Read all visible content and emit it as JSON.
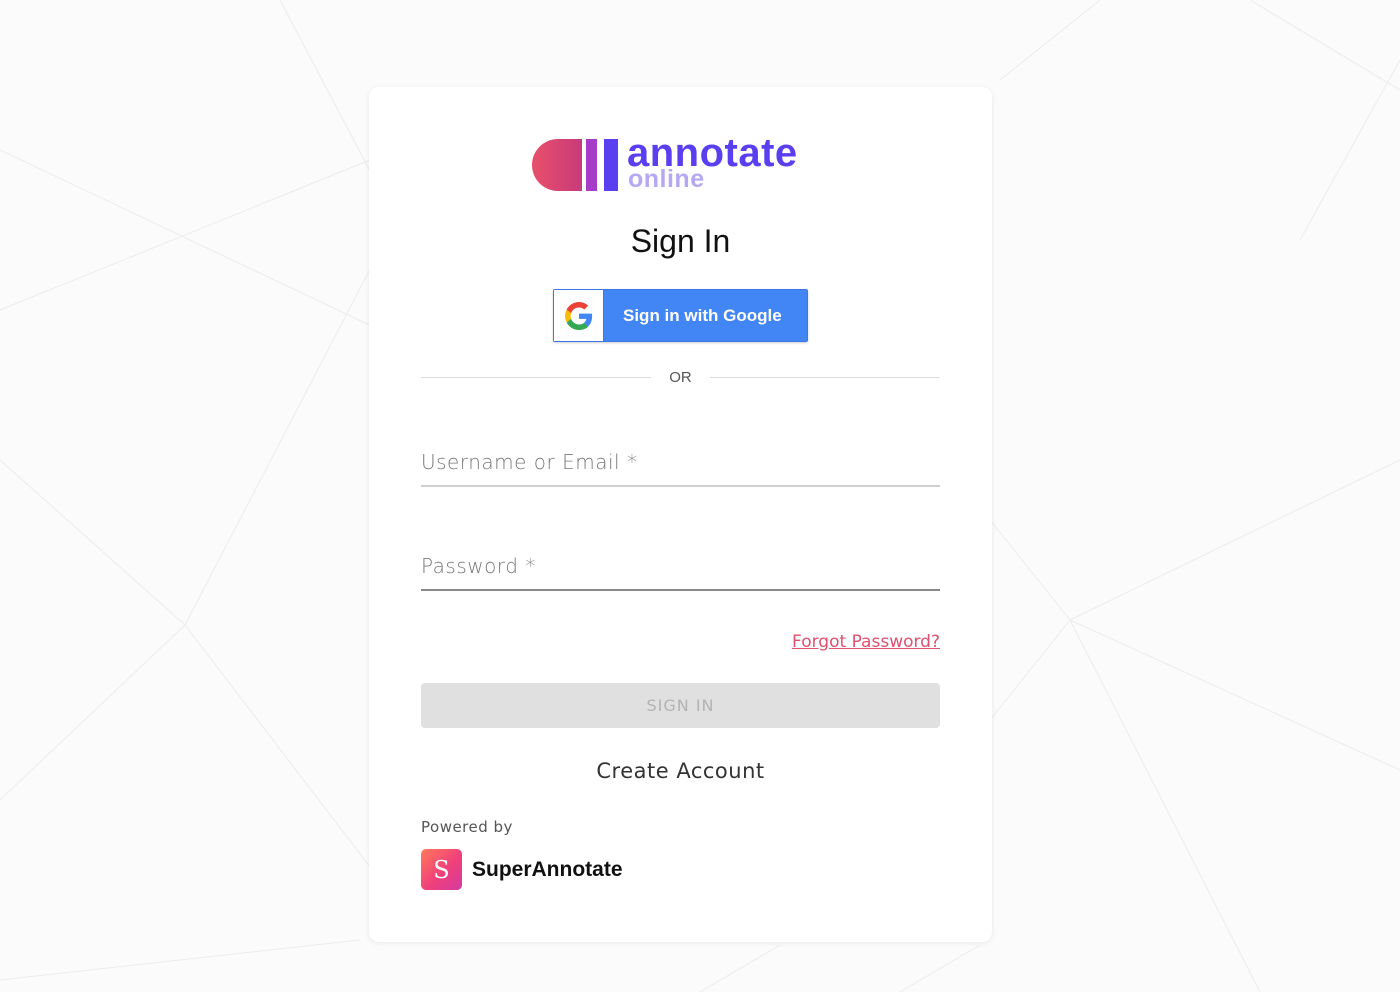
{
  "logo": {
    "word": "annotate",
    "sub": "online"
  },
  "signin": {
    "title": "Sign In",
    "google_label": "Sign in with Google",
    "divider": "OR",
    "username_placeholder": "Username or Email *",
    "password_placeholder": "Password *",
    "forgot_label": "Forgot Password?",
    "submit_label": "SIGN IN",
    "create_label": "Create Account"
  },
  "footer": {
    "powered_by": "Powered by",
    "brand_letter": "S",
    "brand_name": "SuperAnnotate"
  },
  "colors": {
    "brand_purple": "#5a3ff0",
    "google_blue": "#4285f4",
    "forgot_pink": "#e0506e",
    "disabled_bg": "#e0e0e0"
  },
  "icons": {
    "google": "google-g-icon",
    "logo": "annotate-logo-mark",
    "superannotate": "superannotate-logo"
  }
}
